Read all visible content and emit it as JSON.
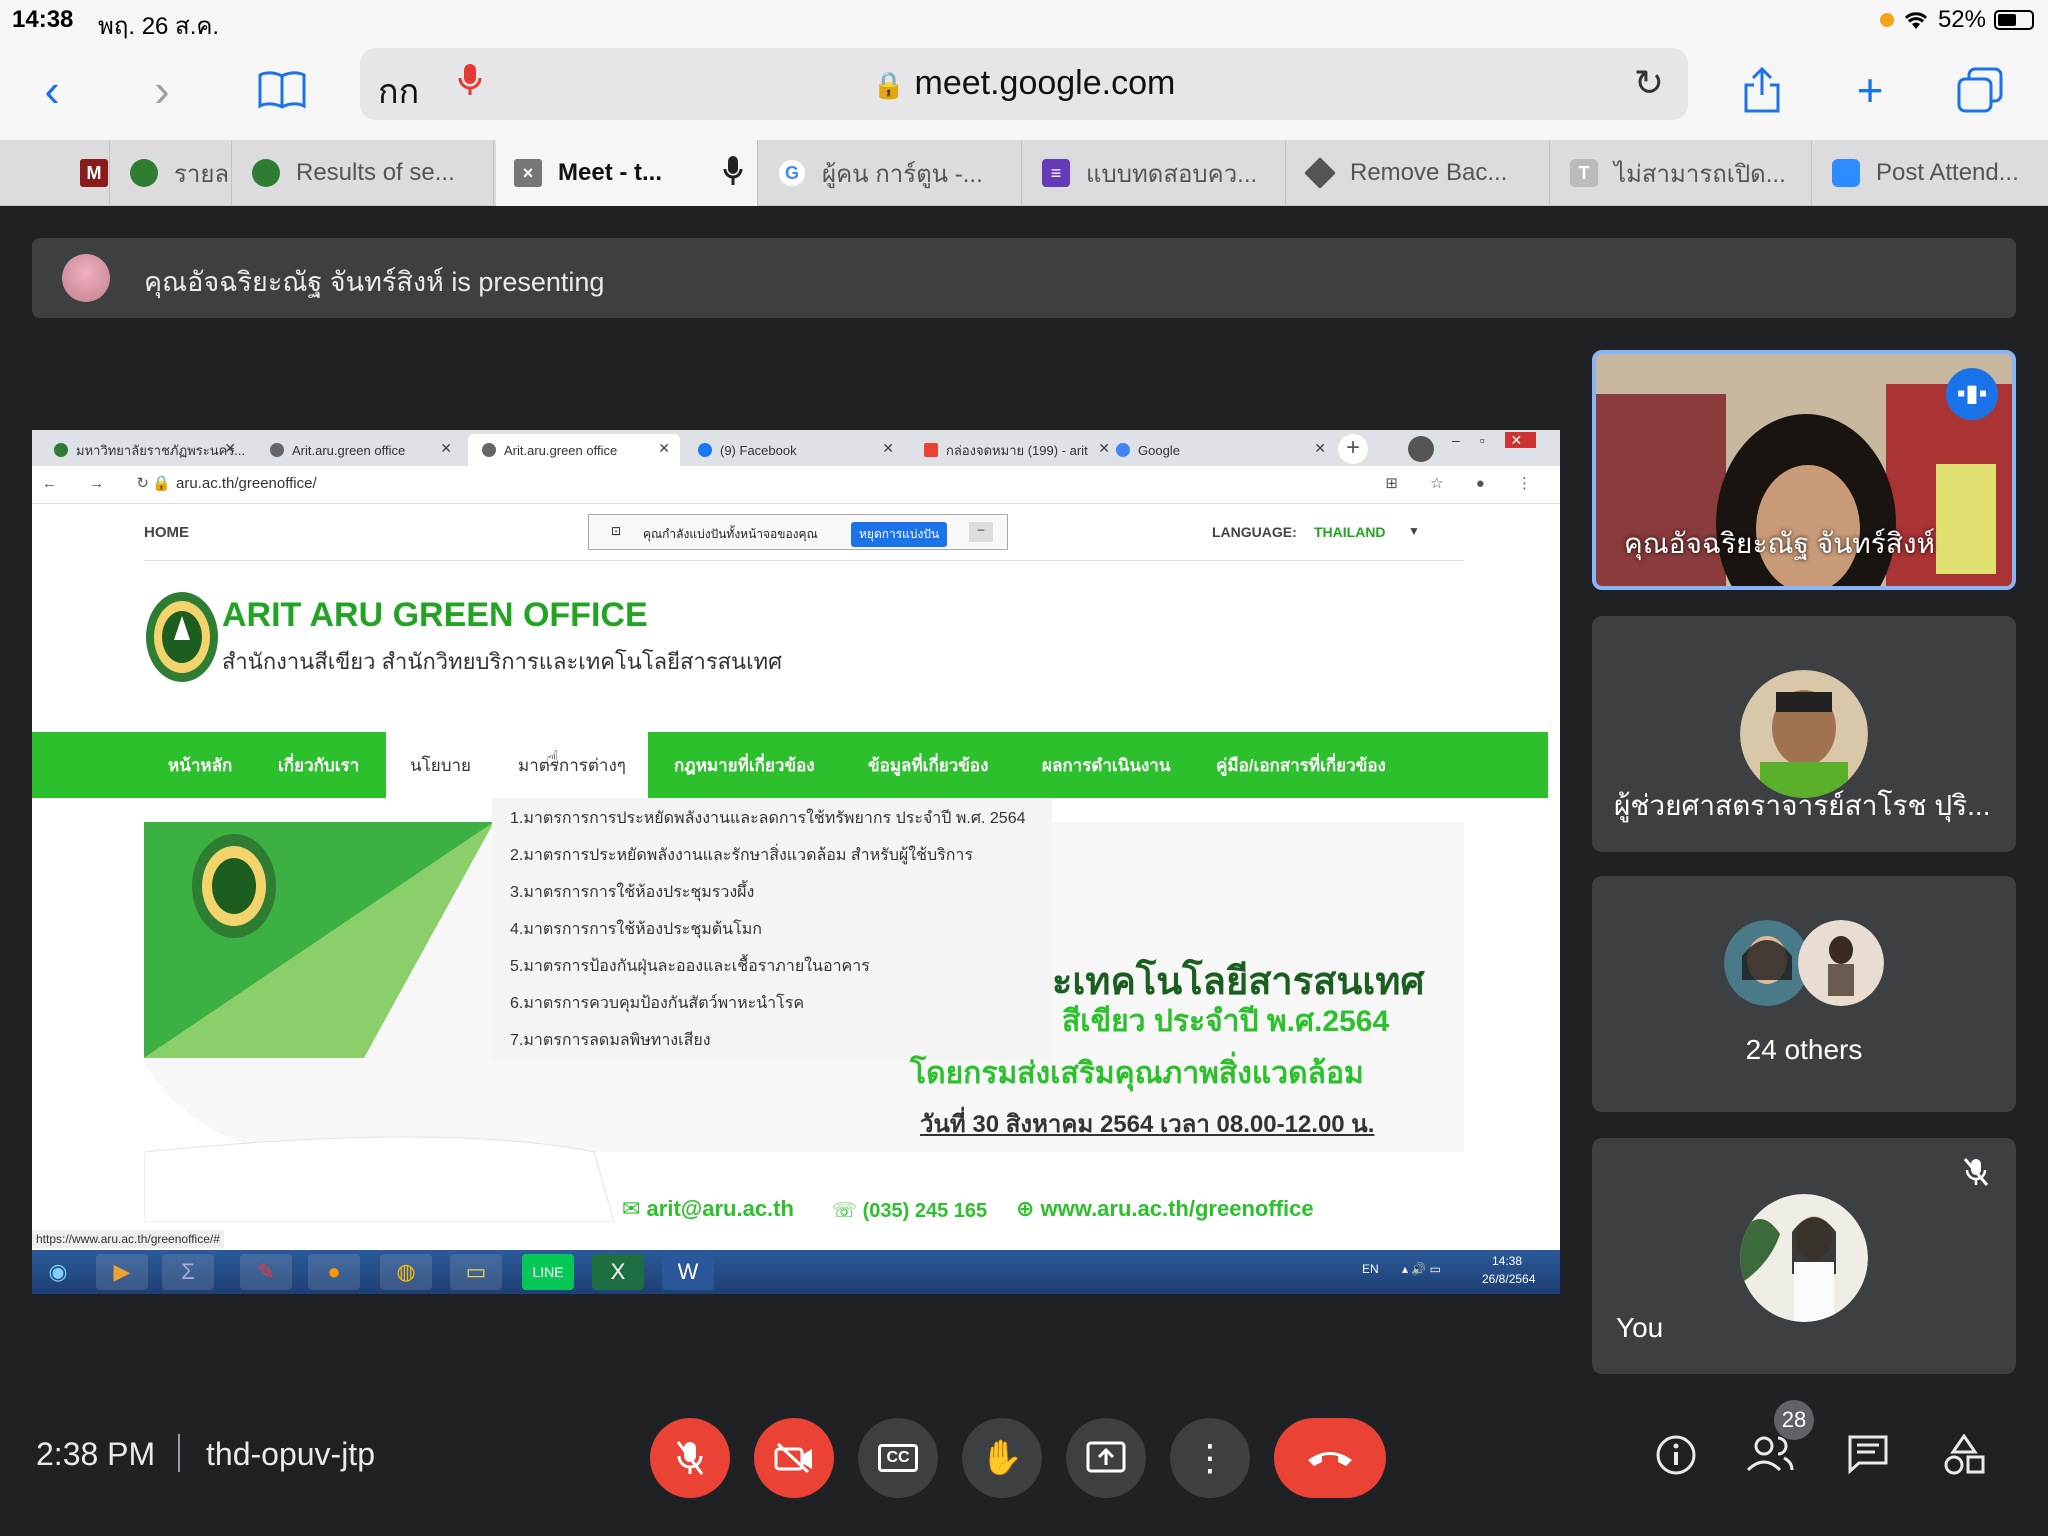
{
  "status_bar": {
    "time": "14:38",
    "date": "พฤ. 26 ส.ค.",
    "battery": "52%"
  },
  "safari": {
    "aa_label": "กก",
    "url_host": "meet.google.com",
    "tabs": [
      {
        "label": "M",
        "favicon": "M"
      },
      {
        "label": "รายล",
        "favicon": ""
      },
      {
        "label": "Results of se...",
        "favicon": ""
      },
      {
        "label": "Meet - t...",
        "favicon": "×"
      },
      {
        "label": "ผู้คน การ์ตูน -...",
        "favicon": "G"
      },
      {
        "label": "แบบทดสอบคว...",
        "favicon": "≡"
      },
      {
        "label": "Remove Bac...",
        "favicon": ""
      },
      {
        "label": "ไม่สามารถเปิด...",
        "favicon": "T"
      },
      {
        "label": "Post Attend...",
        "favicon": ""
      }
    ]
  },
  "meet": {
    "presenting_banner": "คุณอัจฉริยะณัฐ จันทร์สิงห์ is presenting",
    "participants": {
      "presenter": "คุณอัจฉริยะณัฐ จันทร์สิงห์",
      "second": "ผู้ช่วยศาสตราจารย์สาโรช ปุริ...",
      "others": "24 others",
      "you": "You"
    },
    "bottom": {
      "time": "2:38 PM",
      "meeting_code": "thd-opuv-jtp",
      "people_count": "28"
    }
  },
  "shared_screen": {
    "chrome_tabs": [
      "มหาวิทยาลัยราชภัฏพระนคร...",
      "Arit.aru.green office",
      "Arit.aru.green office",
      "(9) Facebook",
      "กล่องจดหมาย (199) - arit",
      "Google"
    ],
    "address": "aru.ac.th/greenoffice/",
    "home": "HOME",
    "share_notice": "คุณกำลังแบ่งปันทั้งหน้าจอของคุณ",
    "stop_share": "หยุดการแบ่งปัน",
    "language_label": "LANGUAGE:",
    "language_value": "THAILAND",
    "site_title": "ARIT ARU GREEN OFFICE",
    "site_subtitle": "สำนักงานสีเขียว สำนักวิทยบริการและเทคโนโลยีสารสนเทศ",
    "nav": [
      "หน้าหลัก",
      "เกี่ยวกับเรา",
      "นโยบาย",
      "มาตรการต่างๆ",
      "กฎหมายที่เกี่ยวข้อง",
      "ข้อมูลที่เกี่ยวข้อง",
      "ผลการดำเนินงาน",
      "คู่มือ/เอกสารที่เกี่ยวข้อง"
    ],
    "dropdown": [
      "1.มาตรการการประหยัดพลังงานและลดการใช้ทรัพยากร ประจำปี พ.ศ. 2564",
      "2.มาตรการประหยัดพลังงานและรักษาสิ่งแวดล้อม สำหรับผู้ใช้บริการ",
      "3.มาตรการการใช้ห้องประชุมรวงผึ้ง",
      "4.มาตรการการใช้ห้องประชุมต้นโมก",
      "5.มาตรการป้องกันฝุ่นละอองและเชื้อราภายในอาคาร",
      "6.มาตรการควบคุมป้องกันสัตว์พาหะนำโรค",
      "7.มาตรการลดมลพิษทางเสียง"
    ],
    "banner_line1": "ะเทคโนโลยีสารสนเทศ",
    "banner_line2": "สีเขียว ประจำปี พ.ศ.2564",
    "banner_line3": "โดยกรมส่งเสริมคุณภาพสิ่งแวดล้อม",
    "banner_line4": "วันที่ 30 สิงหาคม 2564 เวลา 08.00-12.00 น.",
    "contact_email": "arit@aru.ac.th",
    "contact_phone": "(035) 245 165",
    "contact_web": "www.aru.ac.th/greenoffice",
    "status_url": "https://www.aru.ac.th/greenoffice/#",
    "tray_lang": "EN",
    "tray_time": "14:38",
    "tray_date": "26/8/2564"
  },
  "colors": {
    "meet_bg": "#202124",
    "tile_bg": "#3c4043",
    "end_red": "#ea4335",
    "site_green": "#2cc02c",
    "title_green": "#23a323"
  }
}
